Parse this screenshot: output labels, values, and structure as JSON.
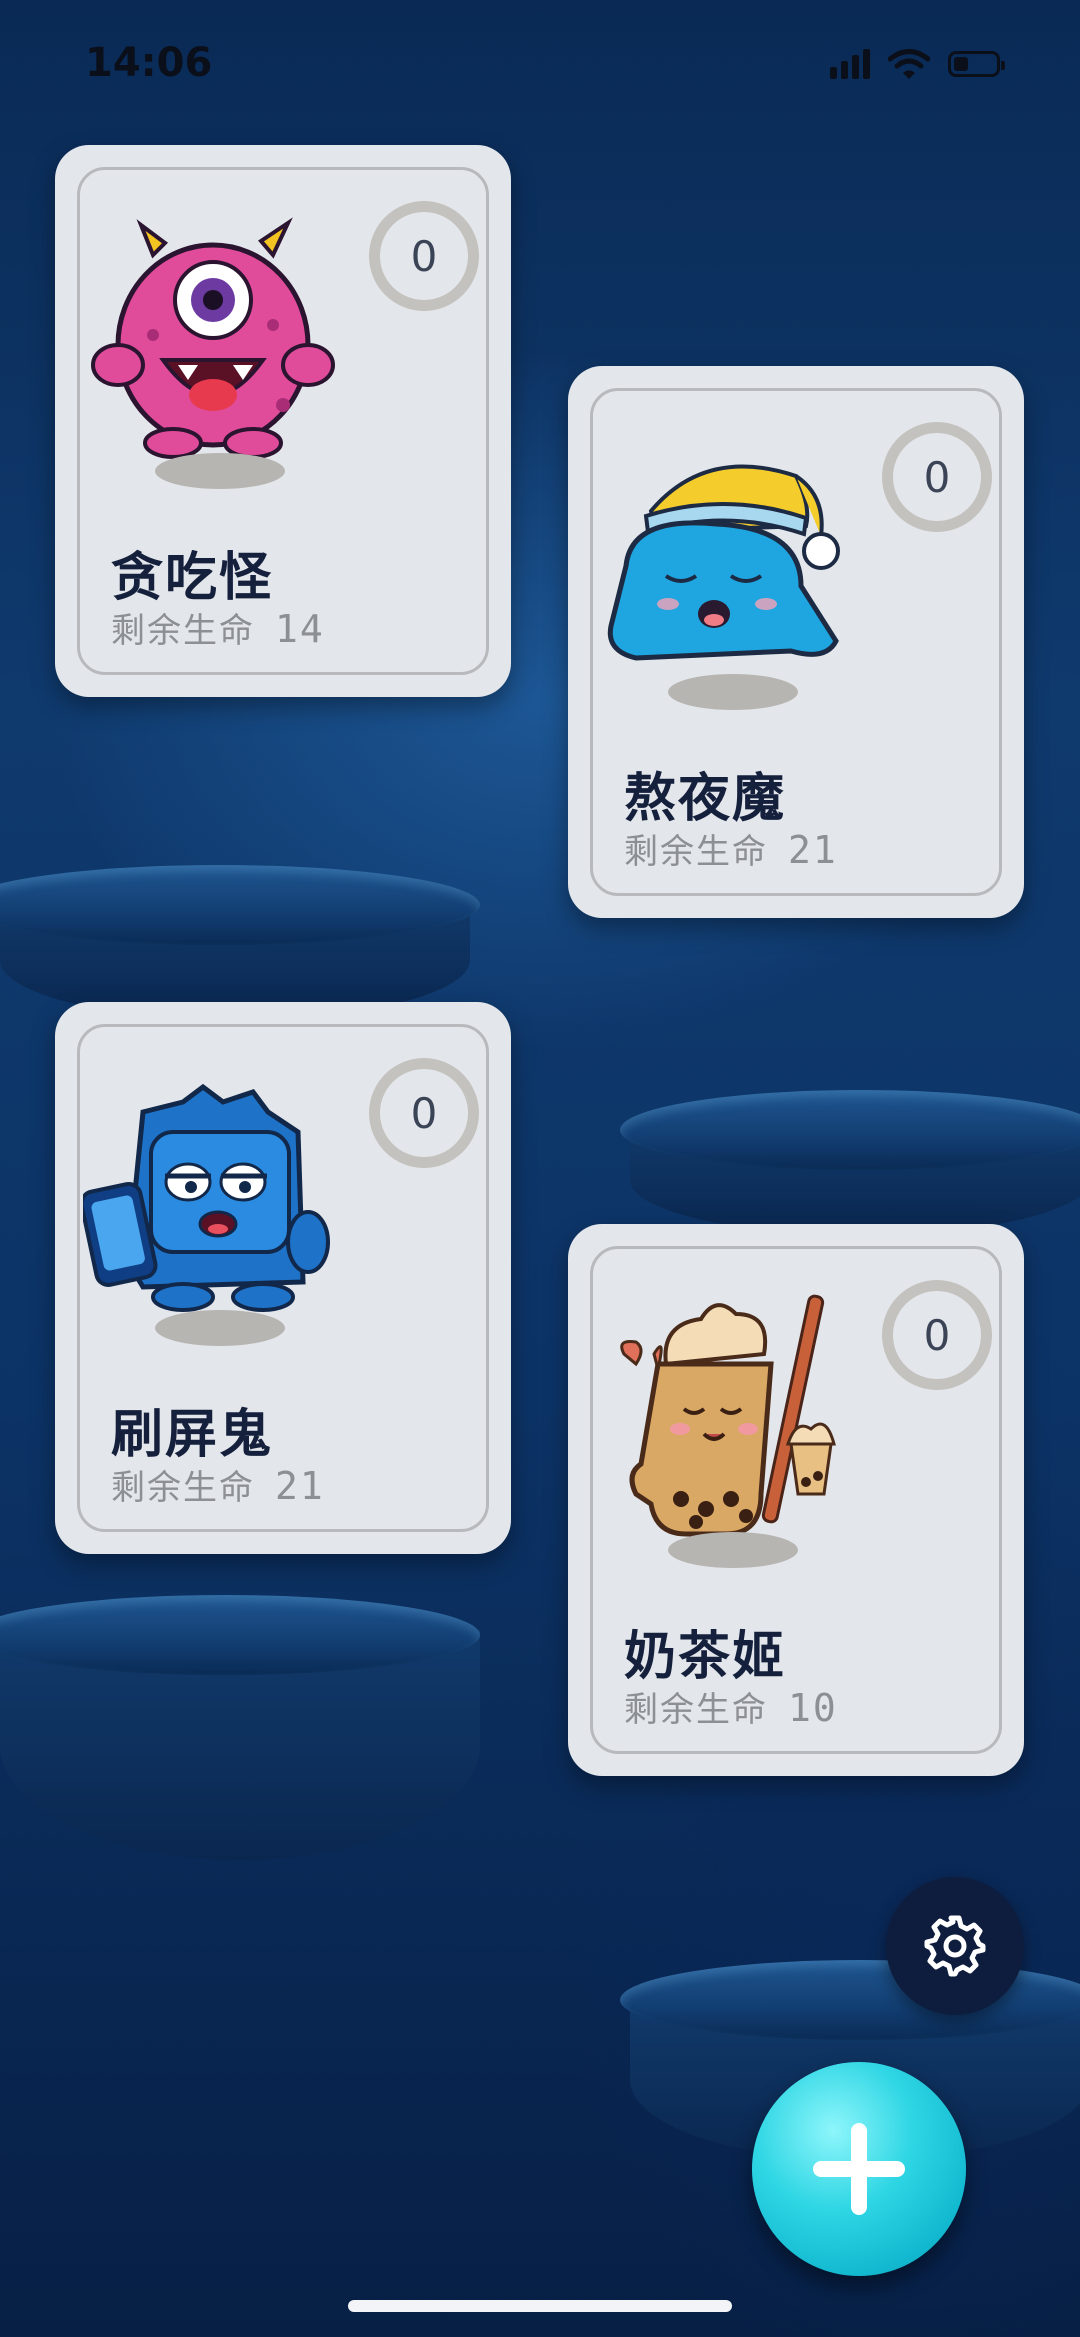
{
  "status_bar": {
    "time": "14:06",
    "signal_icon": "signal-bars-icon",
    "wifi_icon": "wifi-icon",
    "battery_icon": "battery-icon"
  },
  "monsters": [
    {
      "name": "贪吃怪",
      "life_label": "剩余生命",
      "life_value": "14",
      "count": "0",
      "mascot_icon": "pink-cyclops-monster-icon"
    },
    {
      "name": "熬夜魔",
      "life_label": "剩余生命",
      "life_value": "21",
      "count": "0",
      "mascot_icon": "sleepy-blue-blob-icon"
    },
    {
      "name": "刷屏鬼",
      "life_label": "剩余生命",
      "life_value": "21",
      "count": "0",
      "mascot_icon": "phone-box-monster-icon"
    },
    {
      "name": "奶茶姬",
      "life_label": "剩余生命",
      "life_value": "10",
      "count": "0",
      "mascot_icon": "milk-tea-girl-icon"
    }
  ],
  "actions": {
    "settings_icon": "gear-icon",
    "add_icon": "plus-icon"
  },
  "colors": {
    "background": "#0f3a6e",
    "card": "#e3e6ea",
    "accent": "#2fd6e4",
    "name_text": "#15203d"
  }
}
